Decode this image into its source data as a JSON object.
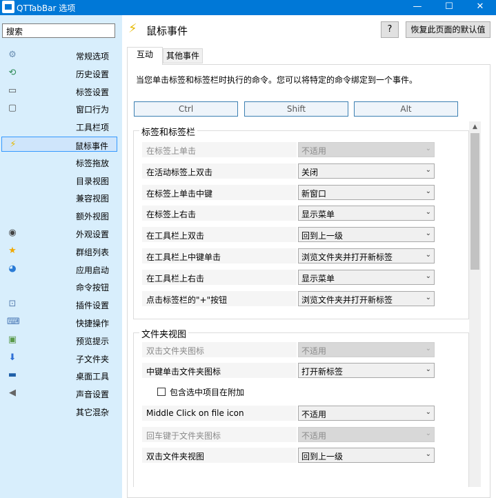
{
  "window": {
    "title": "QTTabBar 选项",
    "min": "—",
    "max": "☐",
    "close": "✕"
  },
  "sidebar": {
    "search_placeholder": "搜索",
    "items": [
      {
        "label": "常规选项",
        "icon": "gear-icon",
        "glyph": "⚙",
        "color": "#6b8fb3"
      },
      {
        "label": "历史设置",
        "icon": "history-icon",
        "glyph": "⟲",
        "color": "#2e8b57"
      },
      {
        "label": "标签设置",
        "icon": "tab-icon",
        "glyph": "▭",
        "color": "#555"
      },
      {
        "label": "窗口行为",
        "icon": "window-icon",
        "glyph": "▢",
        "color": "#555"
      },
      {
        "label": "工具栏项",
        "icon": "",
        "glyph": "",
        "color": "#555"
      },
      {
        "label": "鼠标事件",
        "icon": "lightning-icon",
        "glyph": "⚡",
        "color": "#e6b800"
      },
      {
        "label": "标签拖放",
        "icon": "",
        "glyph": "",
        "color": "#555"
      },
      {
        "label": "目录视图",
        "icon": "",
        "glyph": "",
        "color": "#555"
      },
      {
        "label": "兼容视图",
        "icon": "",
        "glyph": "",
        "color": "#555"
      },
      {
        "label": "额外视图",
        "icon": "",
        "glyph": "",
        "color": "#555"
      },
      {
        "label": "外观设置",
        "icon": "eye-icon",
        "glyph": "◉",
        "color": "#444"
      },
      {
        "label": "群组列表",
        "icon": "star-icon",
        "glyph": "★",
        "color": "#f0a800"
      },
      {
        "label": "应用启动",
        "icon": "globe-icon",
        "glyph": "◕",
        "color": "#2a7bd6"
      },
      {
        "label": "命令按钮",
        "icon": "",
        "glyph": "",
        "color": "#555"
      },
      {
        "label": "插件设置",
        "icon": "plugin-icon",
        "glyph": "⊡",
        "color": "#5a7fb0"
      },
      {
        "label": "快捷操作",
        "icon": "keyboard-icon",
        "glyph": "⌨",
        "color": "#4a78b5"
      },
      {
        "label": "预览提示",
        "icon": "image-icon",
        "glyph": "▣",
        "color": "#5a9a4a"
      },
      {
        "label": "子文件夹",
        "icon": "download-icon",
        "glyph": "⬇",
        "color": "#2f6fd6"
      },
      {
        "label": "桌面工具",
        "icon": "desktop-icon",
        "glyph": "▬",
        "color": "#1e5fa8"
      },
      {
        "label": "声音设置",
        "icon": "speaker-icon",
        "glyph": "◀",
        "color": "#666"
      },
      {
        "label": "其它混杂",
        "icon": "",
        "glyph": "",
        "color": "#555"
      }
    ],
    "selected_index": 5
  },
  "header": {
    "title": "鼠标事件",
    "help": "?",
    "restore": "恢复此页面的默认值"
  },
  "tabs": [
    {
      "label": "互动"
    },
    {
      "label": "其他事件"
    }
  ],
  "description": "当您单击标签和标签栏时执行的命令。您可以将特定的命令绑定到一个事件。",
  "modifiers": [
    "Ctrl",
    "Shift",
    "Alt"
  ],
  "groups": {
    "tabs": {
      "title": "标签和标签栏",
      "rows": [
        {
          "label": "在标签上单击",
          "value": "不适用",
          "disabled": true
        },
        {
          "label": "在活动标签上双击",
          "value": "关闭",
          "disabled": false
        },
        {
          "label": "在标签上单击中键",
          "value": "新窗口",
          "disabled": false
        },
        {
          "label": "在标签上右击",
          "value": "显示菜单",
          "disabled": false
        },
        {
          "label": "在工具栏上双击",
          "value": "回到上一级",
          "disabled": false
        },
        {
          "label": "在工具栏上中键单击",
          "value": "浏览文件夹并打开新标签",
          "disabled": false
        },
        {
          "label": "在工具栏上右击",
          "value": "显示菜单",
          "disabled": false
        },
        {
          "label": "点击标签栏的\"+\"按钮",
          "value": "浏览文件夹并打开新标签",
          "disabled": false
        }
      ]
    },
    "folder": {
      "title": "文件夹视图",
      "rows": [
        {
          "label": "双击文件夹图标",
          "value": "不适用",
          "disabled": true
        },
        {
          "label": "中键单击文件夹图标",
          "value": "打开新标签",
          "disabled": false
        },
        {
          "label": "Middle Click on file icon",
          "value": "不适用",
          "disabled": false
        },
        {
          "label": "回车键于文件夹图标",
          "value": "不适用",
          "disabled": true
        },
        {
          "label": "双击文件夹视图",
          "value": "回到上一级",
          "disabled": false
        }
      ],
      "checkbox": {
        "label": "包含选中项目在附加",
        "checked": false
      }
    }
  }
}
